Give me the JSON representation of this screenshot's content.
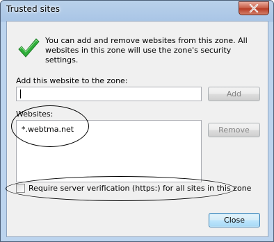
{
  "window": {
    "title": "Trusted sites"
  },
  "info": {
    "message": "You can add and remove websites from this zone. All websites in this zone will use the zone's security settings."
  },
  "add_site": {
    "label": "Add this website to the zone:",
    "value": "",
    "add_button": "Add"
  },
  "websites": {
    "label": "Websites:",
    "items": [
      "*.webtma.net"
    ],
    "remove_button": "Remove"
  },
  "https_option": {
    "label": "Require server verification (https:) for all sites in this zone",
    "checked": false
  },
  "footer": {
    "close_button": "Close"
  },
  "icons": {
    "window_close": "close-x-icon",
    "info": "green-checkmark-icon"
  },
  "colors": {
    "window_frame": "#bcd4ee",
    "close_button": "#c75c45",
    "checkmark": "#2fae3a"
  }
}
